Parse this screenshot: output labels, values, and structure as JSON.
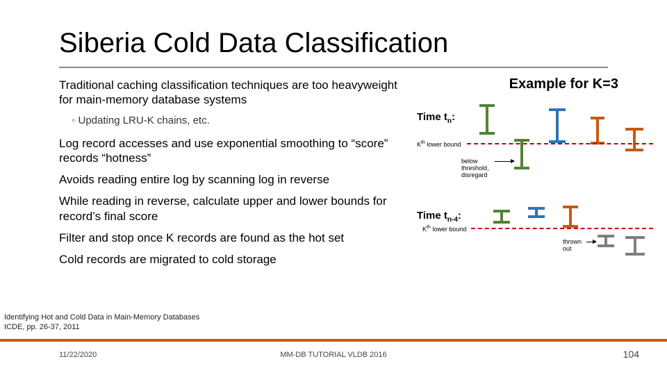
{
  "title": "Siberia Cold Data Classification",
  "paras": {
    "p0": "Traditional caching classification techniques are too heavyweight for main-memory database systems",
    "sub0": "Updating LRU-K chains, etc.",
    "p1": "Log record accesses and use exponential smoothing to “score” records “hotness”",
    "p2": "Avoids reading entire log by scanning log in reverse",
    "p3": "While reading in reverse, calculate upper and lower bounds for record’s final score",
    "p4": "Filter and stop once K records are found as the hot set",
    "p5": "Cold records are migrated to cold storage"
  },
  "example": {
    "title": "Example for K=3",
    "time_n_prefix": "Time t",
    "time_n_sub": "n",
    "time_n_suffix": ":",
    "time_n4_prefix": "Time t",
    "time_n4_sub": "n-4",
    "time_n4_suffix": ":",
    "kth_prefix": "K",
    "kth_sup": "th",
    "kth_rest": " lower bound",
    "below": "below threshold, disregard",
    "thrown": "thrown out"
  },
  "citation": {
    "l1": "Identifying Hot and Cold Data in Main-Memory Databases",
    "l2": "ICDE, pp. 26-37, 2011"
  },
  "footer": {
    "date": "11/22/2020",
    "mid": "MM-DB TUTORIAL VLDB 2016",
    "num": "104"
  },
  "colors": {
    "green": "#548235",
    "blue": "#2e75b6",
    "orange": "#c55a11",
    "gray": "#7f7f7f"
  }
}
